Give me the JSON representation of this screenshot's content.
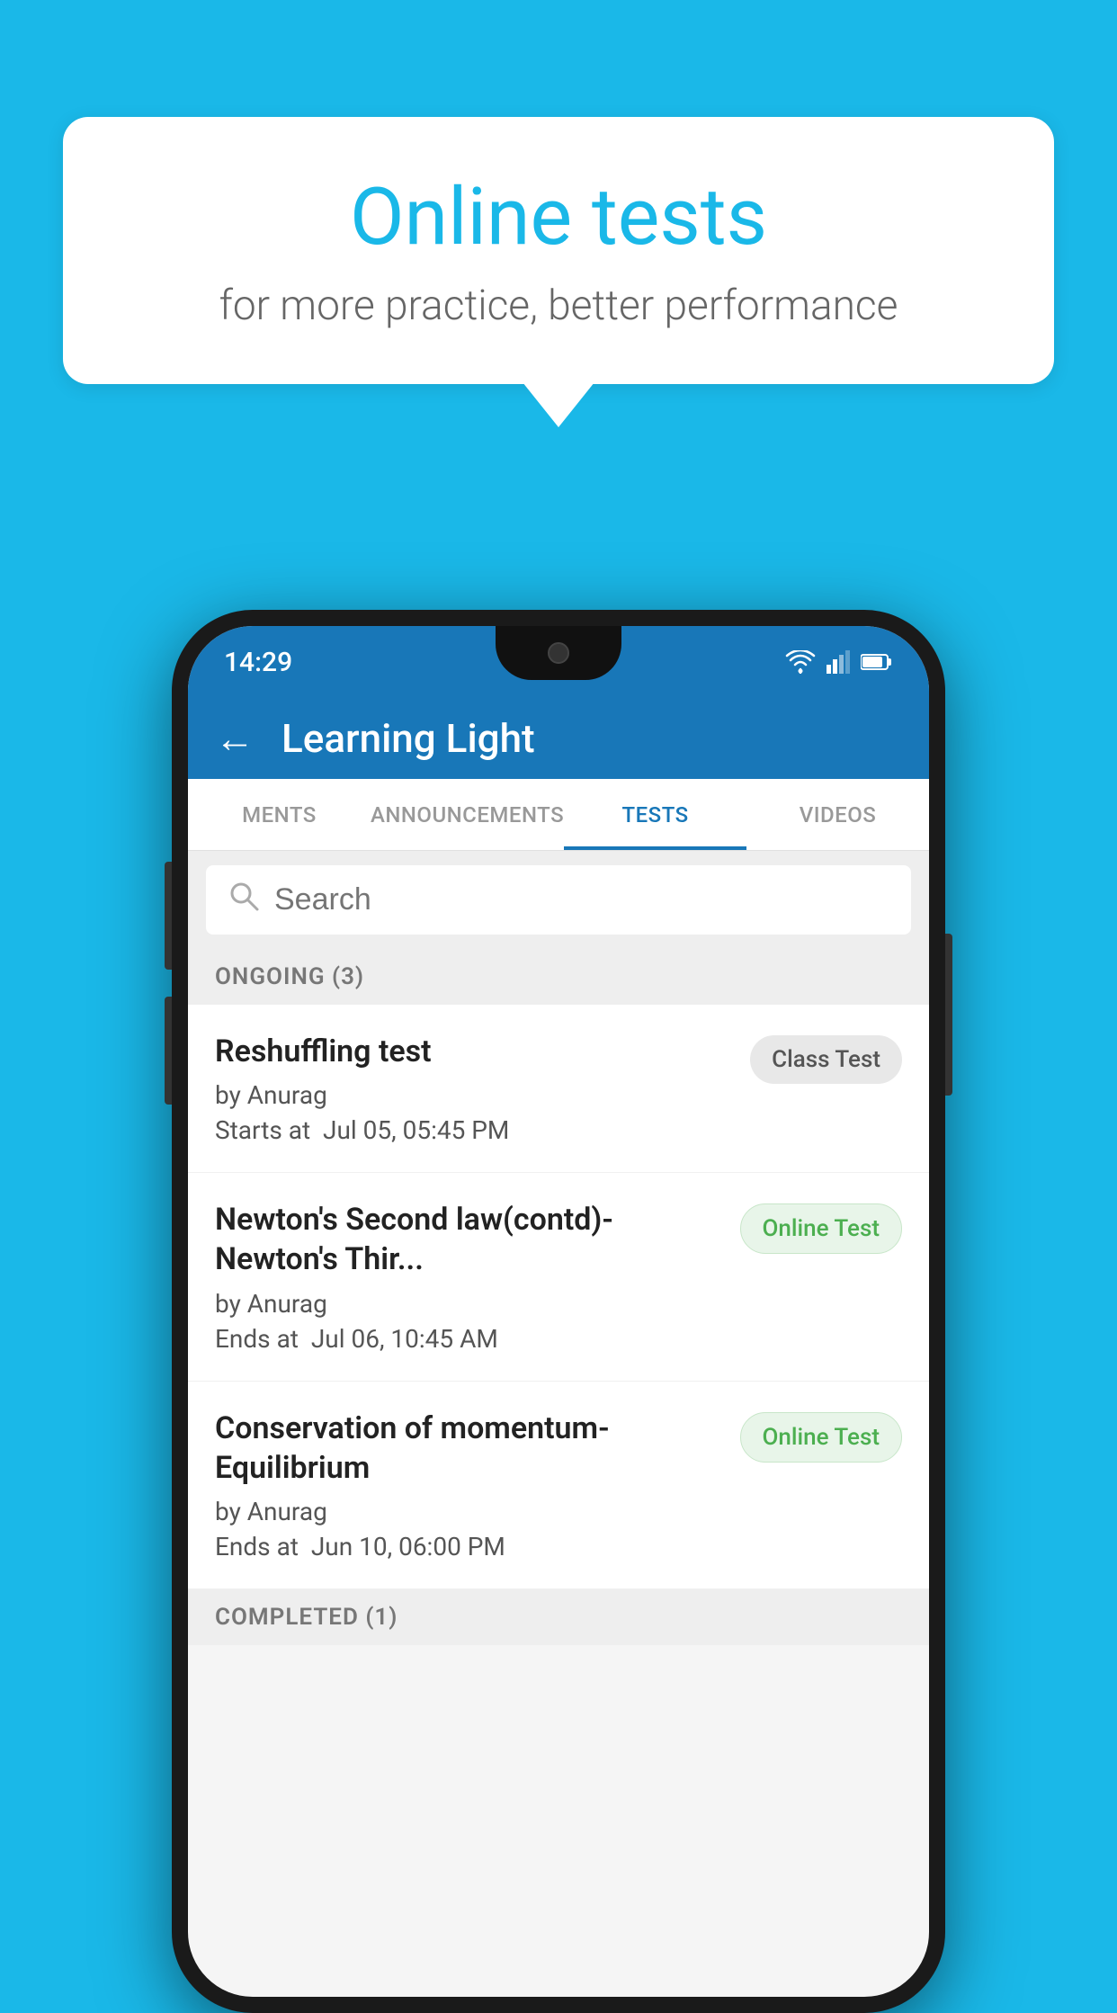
{
  "background_color": "#1ab8e8",
  "speech_bubble": {
    "title": "Online tests",
    "subtitle": "for more practice, better performance"
  },
  "phone": {
    "status_bar": {
      "time": "14:29",
      "wifi": "▾",
      "signal": "◂",
      "battery": "▮"
    },
    "header": {
      "back_label": "←",
      "title": "Learning Light"
    },
    "tabs": [
      {
        "label": "MENTS",
        "active": false
      },
      {
        "label": "ANNOUNCEMENTS",
        "active": false
      },
      {
        "label": "TESTS",
        "active": true
      },
      {
        "label": "VIDEOS",
        "active": false
      }
    ],
    "search": {
      "placeholder": "Search"
    },
    "ongoing_section": {
      "label": "ONGOING (3)"
    },
    "test_items": [
      {
        "name": "Reshuffling test",
        "author": "by Anurag",
        "time_label": "Starts at",
        "time": "Jul 05, 05:45 PM",
        "badge": "Class Test",
        "badge_type": "class"
      },
      {
        "name": "Newton's Second law(contd)-Newton's Thir...",
        "author": "by Anurag",
        "time_label": "Ends at",
        "time": "Jul 06, 10:45 AM",
        "badge": "Online Test",
        "badge_type": "online"
      },
      {
        "name": "Conservation of momentum-Equilibrium",
        "author": "by Anurag",
        "time_label": "Ends at",
        "time": "Jun 10, 06:00 PM",
        "badge": "Online Test",
        "badge_type": "online"
      }
    ],
    "completed_section": {
      "label": "COMPLETED (1)"
    }
  }
}
